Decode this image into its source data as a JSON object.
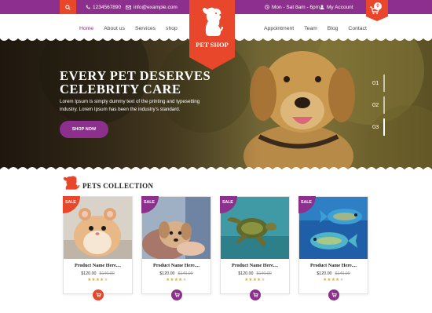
{
  "topbar": {
    "phone": "1234567890",
    "email": "info@example.com",
    "hours": "Mon - Sat 8am - 6pm",
    "account": "My Account",
    "cart_count": "0"
  },
  "logo": {
    "text": "PET SHOP"
  },
  "nav_left": [
    "Home",
    "About us",
    "Services",
    "shop"
  ],
  "nav_right": [
    "Appointment",
    "Team",
    "Blog",
    "Contact"
  ],
  "hero": {
    "title_line1": "EVERY PET DESERVES",
    "title_line2": "CELEBRITY CARE",
    "desc_line1": "Lorem Ipsum is simply dummy text of the printing and typesetting",
    "desc_line2": "industry. Lorem Ipsum has been the industry's standard.",
    "button": "SHOP NOW",
    "slides": [
      "01",
      "02",
      "03"
    ]
  },
  "section": {
    "title": "PETS COLLECTION"
  },
  "products": [
    {
      "badge": "SALE",
      "name": "Product Name Here....",
      "price": "$120.00",
      "old_price": "$140.00",
      "rating": 4,
      "badge_color": "#e8472b"
    },
    {
      "badge": "SALE",
      "name": "Product Name Here....",
      "price": "$120.00",
      "old_price": "$140.00",
      "rating": 4,
      "badge_color": "#8d2f8d"
    },
    {
      "badge": "SALE",
      "name": "Product Name Here....",
      "price": "$120.00",
      "old_price": "$140.00",
      "rating": 4,
      "badge_color": "#8d2f8d"
    },
    {
      "badge": "SALE",
      "name": "Product Name Here....",
      "price": "$120.00",
      "old_price": "$140.00",
      "rating": 4,
      "badge_color": "#8d2f8d"
    }
  ],
  "colors": {
    "purple": "#8d2f8d",
    "orange": "#e8472b"
  }
}
